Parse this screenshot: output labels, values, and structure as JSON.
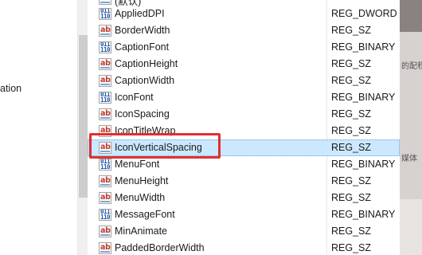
{
  "tree": {
    "partial_label": "ation"
  },
  "values": [
    {
      "name": "(默认)",
      "type": "",
      "icon": "string-value-icon"
    },
    {
      "name": "AppliedDPI",
      "type": "REG_DWORD",
      "icon": "binary-value-icon"
    },
    {
      "name": "BorderWidth",
      "type": "REG_SZ",
      "icon": "string-value-icon"
    },
    {
      "name": "CaptionFont",
      "type": "REG_BINARY",
      "icon": "binary-value-icon"
    },
    {
      "name": "CaptionHeight",
      "type": "REG_SZ",
      "icon": "string-value-icon"
    },
    {
      "name": "CaptionWidth",
      "type": "REG_SZ",
      "icon": "string-value-icon"
    },
    {
      "name": "IconFont",
      "type": "REG_BINARY",
      "icon": "binary-value-icon"
    },
    {
      "name": "IconSpacing",
      "type": "REG_SZ",
      "icon": "string-value-icon"
    },
    {
      "name": "IconTitleWrap",
      "type": "REG_SZ",
      "icon": "string-value-icon"
    },
    {
      "name": "IconVerticalSpacing",
      "type": "REG_SZ",
      "icon": "string-value-icon"
    },
    {
      "name": "MenuFont",
      "type": "REG_BINARY",
      "icon": "binary-value-icon"
    },
    {
      "name": "MenuHeight",
      "type": "REG_SZ",
      "icon": "string-value-icon"
    },
    {
      "name": "MenuWidth",
      "type": "REG_SZ",
      "icon": "string-value-icon"
    },
    {
      "name": "MessageFont",
      "type": "REG_BINARY",
      "icon": "binary-value-icon"
    },
    {
      "name": "MinAnimate",
      "type": "REG_SZ",
      "icon": "string-value-icon"
    },
    {
      "name": "PaddedBorderWidth",
      "type": "REG_SZ",
      "icon": "string-value-icon"
    }
  ],
  "selected_value": "IconVerticalSpacing",
  "colors": {
    "selection": "#cce8ff",
    "highlight_box": "#e03030"
  },
  "right_pane": {
    "partial_text_1": "的配程序",
    "partial_text_2": "媒体"
  }
}
